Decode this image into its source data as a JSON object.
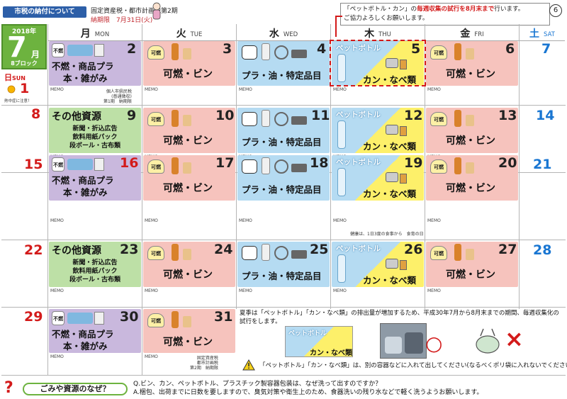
{
  "top": {
    "tax_tag": "市税の納付について",
    "tax_title": "固定資産税・都市計画税第2期",
    "tax_deadline": "納期限　7月31日(火)",
    "notice_pre": "「ペットボトル・カン」の",
    "notice_red": "毎週収集の試行を8月末まで",
    "notice_post": "行います。",
    "notice_line2": "ご協力よろしくお願いします。",
    "page_no": "6"
  },
  "month": {
    "year": "2018年",
    "month": "7",
    "gatsu": "月",
    "block": "8ブロック"
  },
  "headers": {
    "sun": "日",
    "sun_en": "SUN",
    "mon": "月",
    "mon_en": "MON",
    "tue": "火",
    "tue_en": "TUE",
    "wed": "水",
    "wed_en": "WED",
    "thu": "木",
    "thu_en": "THU",
    "fri": "金",
    "fri_en": "FRI",
    "sat": "土",
    "sat_en": "SAT"
  },
  "memo": "MEMO",
  "labels": {
    "mon_a1": "不燃・商品プラ",
    "mon_a2": "本・雑がみ",
    "mon_b_title": "その他資源",
    "mon_b1": "新聞・折込広告",
    "mon_b2": "飲料用紙パック",
    "mon_b3": "段ボール・古布類",
    "tue": "可燃・ビン",
    "wed": "プラ・油・特定品目",
    "thu_pet": "ペットボトル",
    "thu_can": "カン・なべ類",
    "fri": "可燃・ビン",
    "kanen_bag": "可燃",
    "funen_bag": "不燃"
  },
  "days": {
    "d1": "1",
    "d2": "2",
    "d3": "3",
    "d4": "4",
    "d5": "5",
    "d6": "6",
    "d7": "7",
    "d8": "8",
    "d9": "9",
    "d10": "10",
    "d11": "11",
    "d12": "12",
    "d13": "13",
    "d14": "14",
    "d15": "15",
    "d16": "16",
    "d17": "17",
    "d18": "18",
    "d19": "19",
    "d20": "20",
    "d21": "21",
    "d22": "22",
    "d23": "23",
    "d24": "24",
    "d25": "25",
    "d26": "26",
    "d27": "27",
    "d28": "28",
    "d29": "29",
    "d30": "30",
    "d31": "31"
  },
  "notes": {
    "heat": "熱中症に注意！",
    "tax_w1_l1": "個人市県民税",
    "tax_w1_l2": "(普通徴収)",
    "tax_w1_l3": "第1期　納期限",
    "food_day": "健康は、1日3度の食事から　食育の日",
    "tax_31_l1": "固定資産税",
    "tax_31_l2": "都市計画税",
    "tax_31_l3": "第2期　納期限"
  },
  "summer": {
    "text": "夏季は「ペットボトル」「カン・なべ類」の排出量が増加するため、平成30年7月から8月末までの期間、毎週収集化の試行をします。",
    "warn": "「ペットボトル」「カン・なべ類」は、別の容器などに入れて出してください(なるべくポリ袋に入れないでください)。",
    "ok_mark": "○",
    "ng_mark": "×"
  },
  "footer": {
    "mark": "?",
    "question_label": "ごみや資源のなぜ？",
    "q": "Q.ビン、カン、ペットボトル、プラスチック製容器包装は、なぜ洗って出すのですか？",
    "a": "A.梱包、出荷までに日数を要しますので、臭気対策や衛生上のため、食器洗いの残り水などで軽く洗うようお願いします。"
  },
  "colors": {
    "mon": "#c9b8dd",
    "mon_alt": "#bde0a6",
    "tue": "#f6c3bd",
    "wed": "#b5dbf2",
    "thu_blue": "#b5dbf2",
    "thu_yellow": "#fdf06a",
    "fri": "#f6c3bd",
    "sun": "#d31a1a",
    "sat": "#1976d2",
    "brand_green": "#6db33f"
  }
}
